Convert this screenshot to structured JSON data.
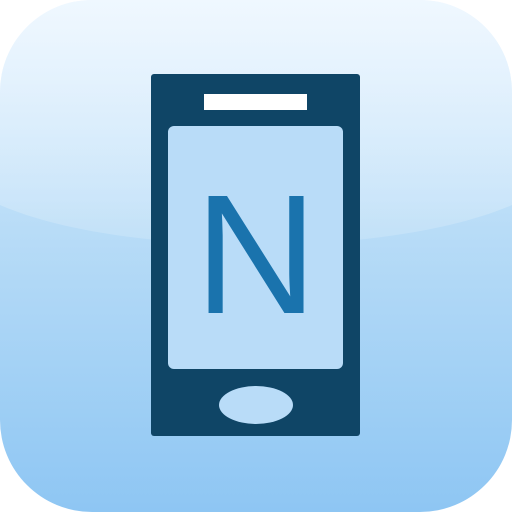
{
  "app_icon": {
    "icon": "smartphone-icon",
    "letter": "N",
    "colors": {
      "background_top": "#dcefff",
      "background_mid": "#b8dcf7",
      "background_bottom": "#8ec6f3",
      "phone_body": "#0f4566",
      "phone_screen": "#b9dcf8",
      "phone_speaker": "#ffffff",
      "phone_home_button": "#b9dcf8",
      "letter": "#1a73ad"
    }
  }
}
